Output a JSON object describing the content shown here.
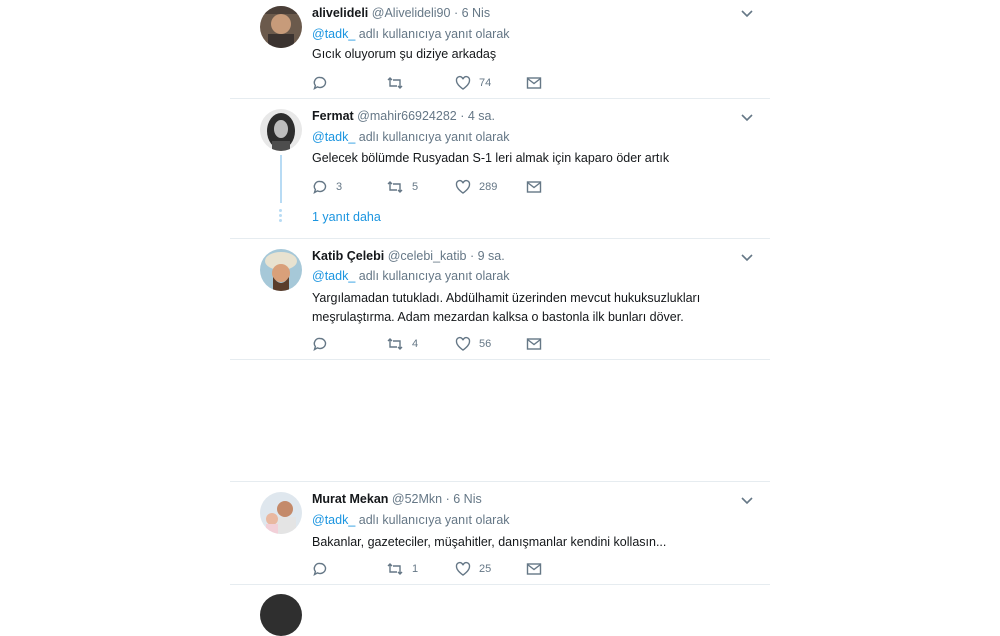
{
  "tweets": [
    {
      "name": "alivelideli",
      "handle": "@Alivelideli90",
      "sep": "·",
      "time": "6 Nis",
      "reply_to_mention": "@tadk_",
      "reply_suffix": "adlı kullanıcıya yanıt olarak",
      "text": "Gıcık oluyorum şu diziye arkadaş",
      "replies": "",
      "retweets": "",
      "likes": "74"
    },
    {
      "name": "Fermat",
      "handle": "@mahir66924282",
      "sep": "·",
      "time": "4 sa.",
      "reply_to_mention": "@tadk_",
      "reply_suffix": "adlı kullanıcıya yanıt olarak",
      "text": "Gelecek bölümde Rusyadan S-1 leri almak için kaparo öder artık",
      "replies": "3",
      "retweets": "5",
      "likes": "289"
    },
    {
      "name": "Katib Çelebi",
      "handle": "@celebi_katib",
      "sep": "·",
      "time": "9 sa.",
      "reply_to_mention": "@tadk_",
      "reply_suffix": "adlı kullanıcıya yanıt olarak",
      "text": "Yargılamadan tutukladı. Abdülhamit üzerinden mevcut hukuksuzlukları meşrulaştırma. Adam mezardan kalksa o bastonla ilk bunları döver.",
      "replies": "",
      "retweets": "4",
      "likes": "56"
    },
    {
      "name": "Murat Mekan",
      "handle": "@52Mkn",
      "sep": "·",
      "time": "6 Nis",
      "reply_to_mention": "@tadk_",
      "reply_suffix": "adlı kullanıcıya yanıt olarak",
      "text": "Bakanlar, gazeteciler, müşahitler, danışmanlar kendini kollasın...",
      "replies": "",
      "retweets": "1",
      "likes": "25"
    }
  ],
  "thread": {
    "more_replies_label": "1 yanıt daha"
  },
  "colors": {
    "accent": "#1b95e0",
    "muted": "#657786",
    "thread_line": "#b8dbf4",
    "divider": "#e6ecf0"
  },
  "icons": [
    "reply-icon",
    "retweet-icon",
    "like-heart-icon",
    "direct-message-icon",
    "caret-down-icon"
  ]
}
